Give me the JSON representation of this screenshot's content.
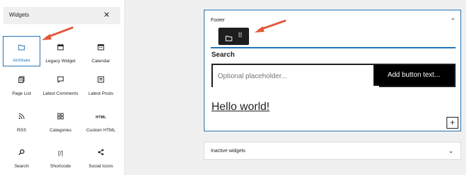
{
  "widgets_panel": {
    "title": "Widgets",
    "close_symbol": "✕",
    "items": [
      {
        "label": "Archives",
        "icon": "folder-icon",
        "selected": true
      },
      {
        "label": "Legacy Widget",
        "icon": "calendar-widget-icon"
      },
      {
        "label": "Calendar",
        "icon": "calendar-icon"
      },
      {
        "label": "Page List",
        "icon": "pages-icon"
      },
      {
        "label": "Latest Comments",
        "icon": "comment-icon"
      },
      {
        "label": "Latest Posts",
        "icon": "list-icon"
      },
      {
        "label": "RSS",
        "icon": "rss-icon"
      },
      {
        "label": "Categories",
        "icon": "categories-icon"
      },
      {
        "label": "Custom HTML",
        "icon": "html-icon",
        "glyph": "HTML"
      },
      {
        "label": "Search",
        "icon": "search-icon"
      },
      {
        "label": "Shortcode",
        "icon": "shortcode-icon",
        "glyph": "[/]"
      },
      {
        "label": "Social Icons",
        "icon": "share-icon"
      }
    ]
  },
  "footer_area": {
    "title": "Footer",
    "caret": "^",
    "search_block": {
      "label": "Search",
      "placeholder": "Optional placeholder...",
      "button_label": "Add button text..."
    },
    "paragraph": "Hello world!",
    "add_block_symbol": "+"
  },
  "inactive_area": {
    "title": "Inactive widgets",
    "caret": "⌄"
  },
  "colors": {
    "accent": "#2271b1",
    "arrow": "#e2573b",
    "toolbar": "#1e1e1e"
  }
}
